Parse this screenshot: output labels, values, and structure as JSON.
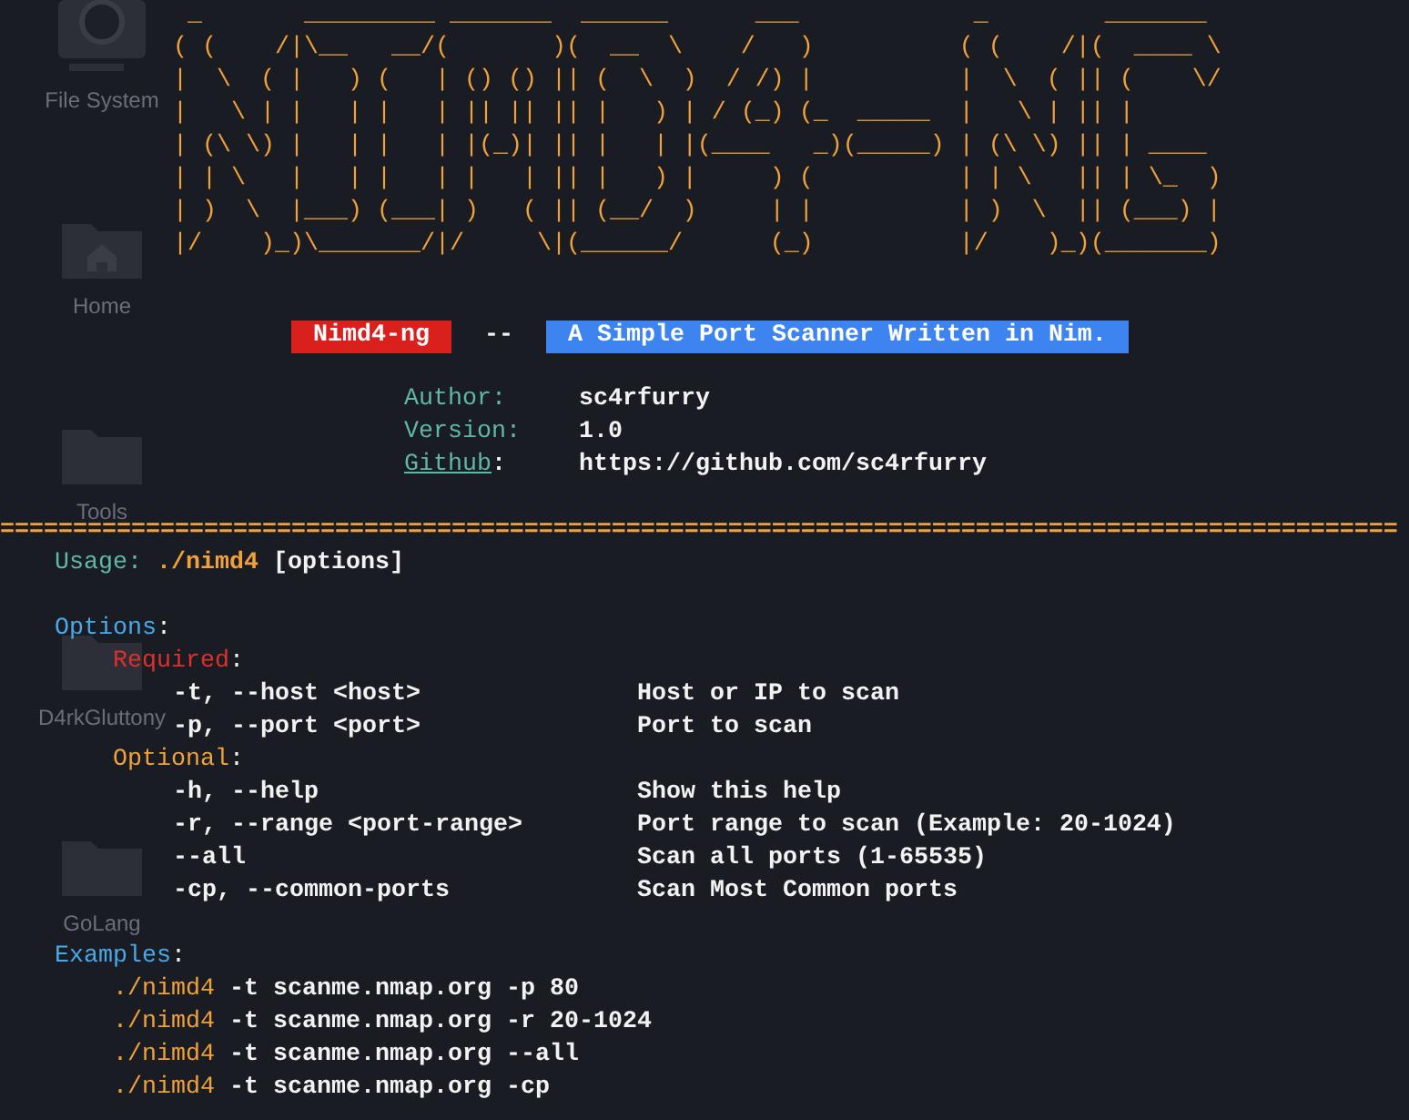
{
  "desktop_icons": [
    {
      "label": "File System",
      "kind": "drive"
    },
    {
      "label": "Home",
      "kind": "home"
    },
    {
      "label": "Tools",
      "kind": "folder"
    },
    {
      "label": "D4rkGluttony",
      "kind": "folder"
    },
    {
      "label": "GoLang",
      "kind": "folder"
    }
  ],
  "terminal": {
    "banner_art": [
      " _       _________ _______  ______      ___            _        _______ ",
      "( (    /|\\__   __/(       )(  __  \\    /   )          ( (    /|(  ____ \\",
      "|  \\  ( |   ) (   | () () || (  \\  )  / /) |          |  \\  ( || (    \\/",
      "|   \\ | |   | |   | || || || |   ) | / (_) (_  _____  |   \\ | || |      ",
      "| (\\ \\) |   | |   | |(_)| || |   | |(____   _)(_____) | (\\ \\) || | ____ ",
      "| | \\   |   | |   | |   | || |   ) |     ) (          | | \\   || | \\_  )",
      "| )  \\  |___) (___| )   ( || (__/  )     | |          | )  \\  || (___) |",
      "|/    )_)\\_______/|/     \\|(______/      (_)          |/    )_)(_______)"
    ],
    "title_tag": "Nimd4-ng",
    "title_separator": "--",
    "tagline": "A Simple Port Scanner Written in Nim.",
    "info": [
      {
        "label": "Author:",
        "value": "sc4rfurry",
        "link": false
      },
      {
        "label": "Version:",
        "value": "1.0",
        "link": false
      },
      {
        "label": "Github",
        "suffix": ":",
        "value": "https://github.com/sc4rfurry",
        "link": true
      }
    ],
    "rule": "================================================================================================",
    "usage": {
      "label": "Usage:",
      "command": "./nimd4",
      "args": "[options]"
    },
    "options": {
      "heading": "Options",
      "suffix": ":",
      "groups": [
        {
          "name": "Required",
          "suffix": ":",
          "kind": "required",
          "items": [
            {
              "flag": "-t, --host <host>",
              "description": "Host or IP to scan"
            },
            {
              "flag": "-p, --port <port>",
              "description": "Port to scan"
            }
          ]
        },
        {
          "name": "Optional",
          "suffix": ":",
          "kind": "optional",
          "items": [
            {
              "flag": "-h, --help",
              "description": "Show this help"
            },
            {
              "flag": "-r, --range <port-range>",
              "description": "Port range to scan (Example: 20-1024)"
            },
            {
              "flag": "--all",
              "description": "Scan all ports (1-65535)"
            },
            {
              "flag": "-cp, --common-ports",
              "description": "Scan Most Common ports"
            }
          ]
        }
      ]
    },
    "examples": {
      "heading": "Examples",
      "suffix": ":",
      "items": [
        {
          "command": "./nimd4",
          "args": "-t scanme.nmap.org -p 80"
        },
        {
          "command": "./nimd4",
          "args": "-t scanme.nmap.org -r 20-1024"
        },
        {
          "command": "./nimd4",
          "args": "-t scanme.nmap.org --all"
        },
        {
          "command": "./nimd4",
          "args": "-t scanme.nmap.org -cp"
        }
      ]
    }
  }
}
